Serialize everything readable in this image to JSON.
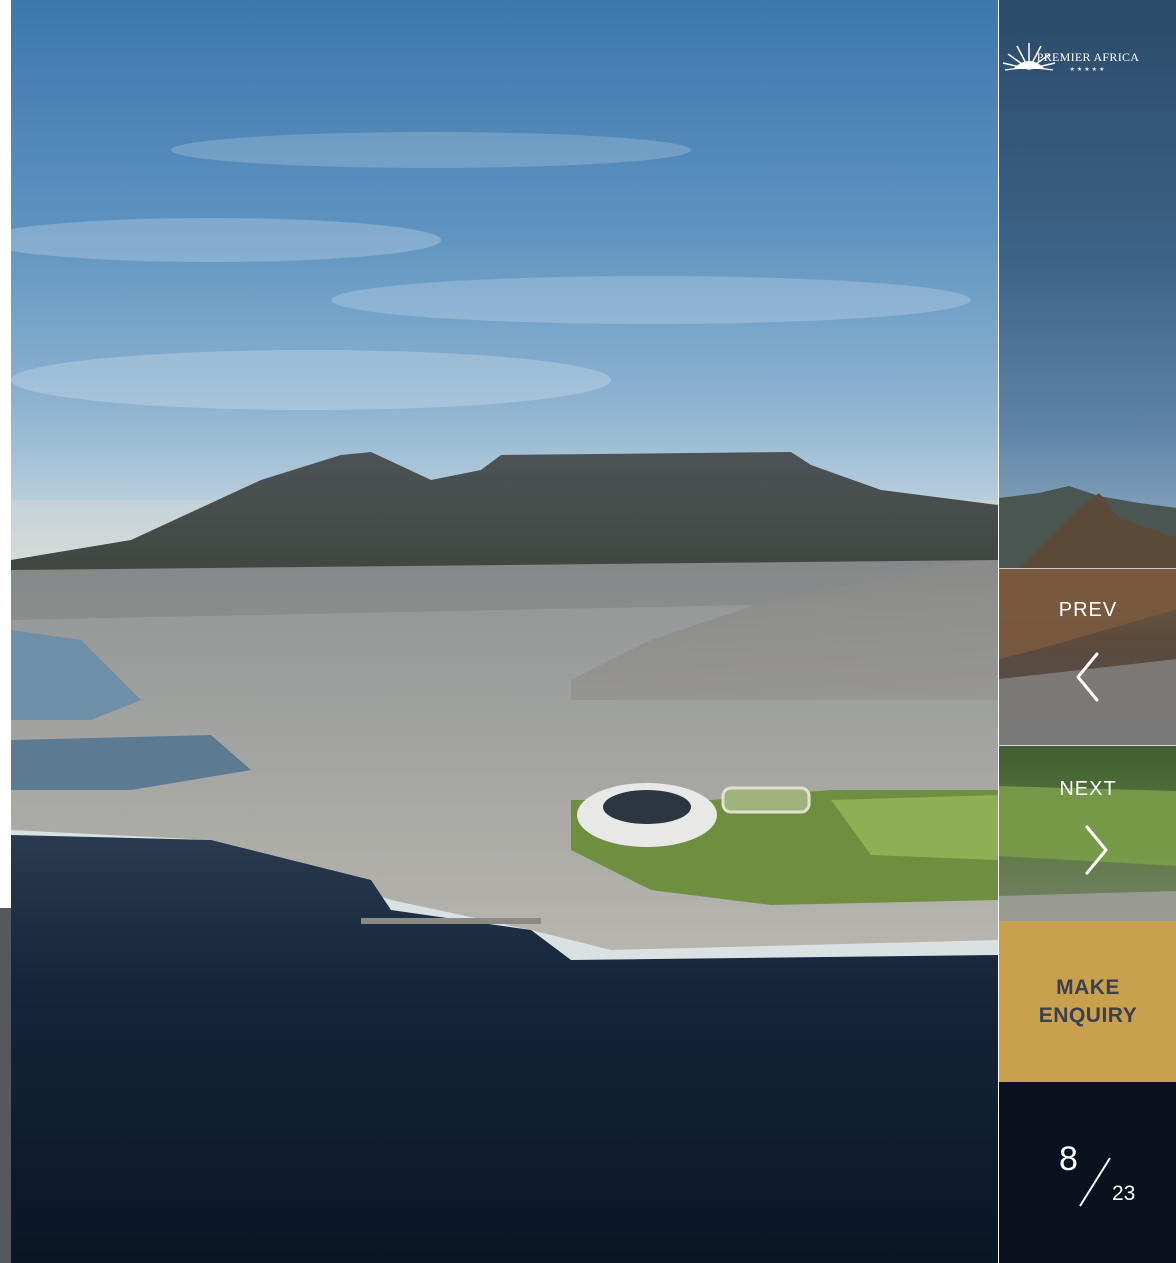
{
  "brand": {
    "name": "PREMIER AFRICA",
    "stars": "★★★★★"
  },
  "nav": {
    "prev_label": "PREV",
    "next_label": "NEXT",
    "prev_icon": "chevron-left-icon",
    "next_icon": "chevron-right-icon"
  },
  "enquiry": {
    "label": "MAKE ENQUIRY",
    "background": "#c9a04e",
    "text_color": "#3a3f52"
  },
  "counter": {
    "current": "8",
    "total": "23"
  },
  "colors": {
    "counter_bg": "#0a1220",
    "sky_top": "#3e77ad",
    "sea": "#101c2c"
  }
}
